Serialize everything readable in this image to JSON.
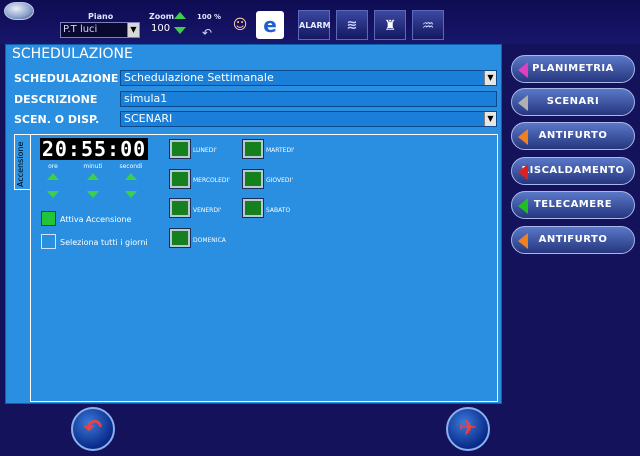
{
  "header": {
    "piano_label": "Piano",
    "piano_value": "P.T luci",
    "zoom_label": "Zoom",
    "zoom_value": "100",
    "zoom_pct_label": "100 %",
    "alarm_label": "ALARM"
  },
  "main": {
    "title": "SCHEDULAZIONE",
    "fields": [
      {
        "label": "SCHEDULAZIONE",
        "value": "Schedulazione Settimanale",
        "type": "select"
      },
      {
        "label": "DESCRIZIONE",
        "value": "simula1",
        "type": "text"
      },
      {
        "label": "SCEN. O DISP.",
        "value": "SCENARI",
        "type": "select"
      }
    ],
    "tab_label": "Accensione",
    "clock": "20:55:00",
    "clock_labels": {
      "hours": "ore",
      "minutes": "minuti",
      "seconds": "secondi"
    },
    "activate_label": "Attiva Accensione",
    "select_all_label": "Seleziona tutti i giorni",
    "days": [
      "LUNEDI'",
      "MARTEDI'",
      "MERCOLEDI'",
      "GIOVEDI'",
      "VENERDI'",
      "SABATO",
      "DOMENICA"
    ]
  },
  "nav": {
    "items": [
      {
        "label": "PLANIMETRIA",
        "color": "#e040c0"
      },
      {
        "label": "SCENARI",
        "color": "#b0b0b0"
      },
      {
        "label": "ANTIFURTO",
        "color": "#f08020"
      },
      {
        "label": "RISCALDAMENTO",
        "color": "#e02020"
      },
      {
        "label": "TELECAMERE",
        "color": "#20c020"
      },
      {
        "label": "ANTIFURTO",
        "color": "#f08020"
      }
    ]
  },
  "icons": [
    "logo-icon",
    "zoom-up-icon",
    "zoom-down-icon",
    "undo-icon",
    "person-icon",
    "ie-browser-icon",
    "alarm-icon",
    "heating-icon",
    "extinguisher-icon",
    "water-tap-icon",
    "back-icon",
    "exit-run-icon"
  ]
}
